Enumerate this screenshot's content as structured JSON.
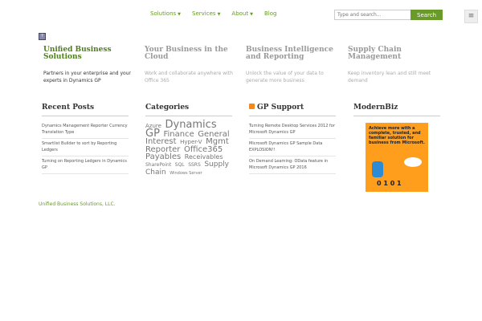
{
  "nav": {
    "solutions": "Solutions",
    "services": "Services",
    "about": "About",
    "blog": "Blog"
  },
  "search": {
    "placeholder": "Type and search...",
    "button": "Search"
  },
  "features": [
    {
      "title": "Unified Business Solutions",
      "text": "Partners in your enterprise and your experts in Dynamics GP"
    },
    {
      "title": "Your Business in the Cloud",
      "text": "Work and collaborate anywhere with Office 365"
    },
    {
      "title": "Business Intelligence and Reporting",
      "text": "Unlock the value of your data to generate more business"
    },
    {
      "title": "Supply Chain Management",
      "text": "Keep inventory lean and still meet demand"
    }
  ],
  "widgets": {
    "recent_title": "Recent Posts",
    "recent": [
      "Dynamics Management Reporter Currency Translation Type",
      "Smartlist Builder to sort by Reporting Ledgers",
      "Turning on Reporting Ledgers in Dynamics GP"
    ],
    "categories_title": "Categories",
    "tags": [
      "Azure",
      "Dynamics GP",
      "Finance",
      "General Interest",
      "Hyper-V",
      "Mgmt Reporter",
      "Office365",
      "Payables",
      "Receivables",
      "SharePoint",
      "SQL",
      "SSRS",
      "Supply Chain",
      "Windows Server"
    ],
    "gp_title": "GP Support",
    "gp": [
      "Turning Remote Desktop Services 2012 for Microsoft Dynamics GP",
      "Microsoft Dynamics GP Sample Data EXPLOSION!!",
      "On Demand Learning: OData feature in Microsoft Dynamics GP 2016"
    ],
    "modernbiz_title": "ModernBiz",
    "ad_text": "Achieve more with a complete, trusted, and familiar solution for business from Microsoft.",
    "ad_digits": "0 1 0 1"
  },
  "footer": "Unified Business Solutions, LLC."
}
